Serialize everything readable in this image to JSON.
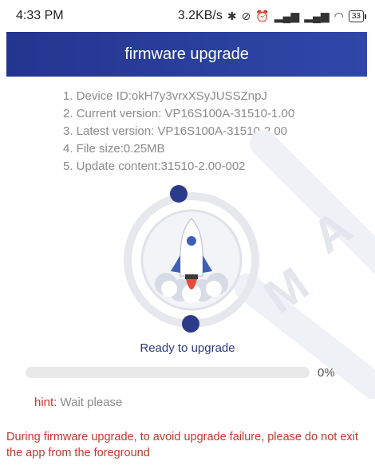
{
  "status_bar": {
    "time": "4:33 PM",
    "network_speed": "3.2KB/s",
    "icons": [
      "bluetooth-icon",
      "mute-icon",
      "alarm-icon",
      "signal-hd-icon",
      "signal-hd-icon",
      "wifi-icon"
    ],
    "battery": "33"
  },
  "header": {
    "title": "firmware upgrade"
  },
  "info": {
    "device_id": "1. Device ID:okH7y3vrxXSyJUSSZnpJ",
    "current_version": "2. Current version: VP16S100A-31510-1.00",
    "latest_version": "3. Latest version: VP16S100A-31510-2.00",
    "file_size": "4. File size:0.25MB",
    "update_content": "5. Update content:31510-2.00-002"
  },
  "status_text": "Ready to upgrade",
  "progress": {
    "value": 0,
    "label": "0%"
  },
  "hint": {
    "label": "hint:",
    "value": "Wait please"
  },
  "warning": "During firmware upgrade, to avoid upgrade failure, please do not exit the app from the foreground",
  "colors": {
    "header": "#2f48a8",
    "accent": "#2c3a8a",
    "warning": "#c0392b"
  }
}
